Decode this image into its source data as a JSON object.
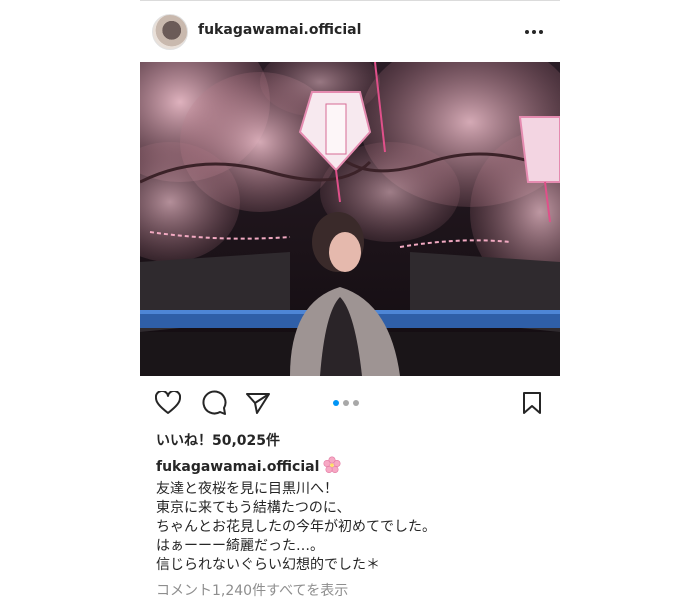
{
  "post": {
    "username": "fukagawamai.official",
    "likes_text": "いいね！50,025件",
    "caption": {
      "username": "fukagawamai.official",
      "emoji": "cherry-blossom",
      "lines": [
        "友達と夜桜を見に目黒川へ！",
        "東京に来てもう結構たつのに、",
        "ちゃんとお花見したの今年が初めてでした。",
        "はぁーーー綺麗だった…。",
        "信じられないぐらい幻想的でした＊"
      ]
    },
    "comments_link": "コメント1,240件すべてを表示",
    "carousel": {
      "total": 3,
      "current": 1
    }
  },
  "icons": {
    "more": "more-horizontal-icon",
    "like": "heart-icon",
    "comment": "comment-icon",
    "share": "paper-plane-icon",
    "save": "bookmark-icon"
  },
  "colors": {
    "text": "#262626",
    "muted": "#8e8e8e",
    "accent": "#0095f6",
    "inactive_dot": "#a8a8a8"
  }
}
